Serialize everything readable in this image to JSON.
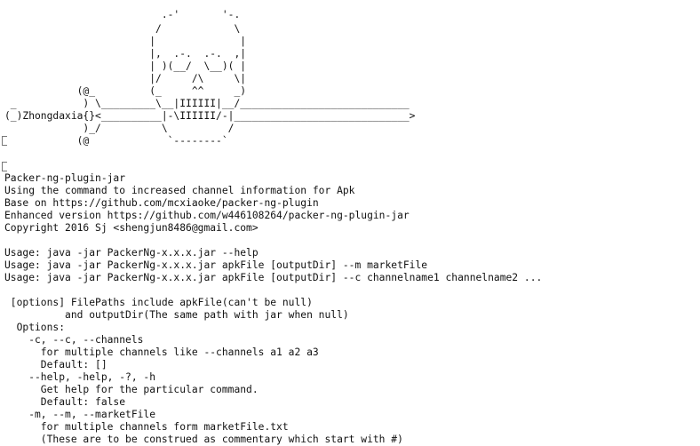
{
  "terminal": {
    "banner": [
      "                          .-'       '-.",
      "                         /            \\",
      "                        |              |",
      "                        |,  .-.  .-.  ,|",
      "                        | )(__/  \\__)( |",
      "                        |/     /\\     \\|",
      "            (@_         (_     ^^     _)",
      " _           ) \\_________\\__|IIIIII|__/____________________________",
      "(_)Zhongdaxia{}<__________|-\\IIIIII/-|_____________________________>",
      "             )_/          \\          /",
      "            (@             `--------`"
    ],
    "output": [
      "Packer-ng-plugin-jar",
      "Using the command to increased channel information for Apk",
      "Base on https://github.com/mcxiaoke/packer-ng-plugin",
      "Enhanced version https://github.com/w446108264/packer-ng-plugin-jar",
      "Copyright 2016 Sj <shengjun8486@gmail.com>",
      "",
      "Usage: java -jar PackerNg-x.x.x.jar --help",
      "Usage: java -jar PackerNg-x.x.x.jar apkFile [outputDir] --m marketFile",
      "Usage: java -jar PackerNg-x.x.x.jar apkFile [outputDir] --c channelname1 channelname2 ...",
      "",
      " [options] FilePaths include apkFile(can't be null)",
      "          and outputDir(The same path with jar when null)",
      "  Options:",
      "    -c, --c, --channels",
      "      for multiple channels like --channels a1 a2 a3",
      "      Default: []",
      "    --help, -help, -?, -h",
      "      Get help for the particular command.",
      "      Default: false",
      "    -m, --m, --marketFile",
      "      for multiple channels form marketFile.txt",
      "      (These are to be construed as commentary which start with #)"
    ]
  }
}
